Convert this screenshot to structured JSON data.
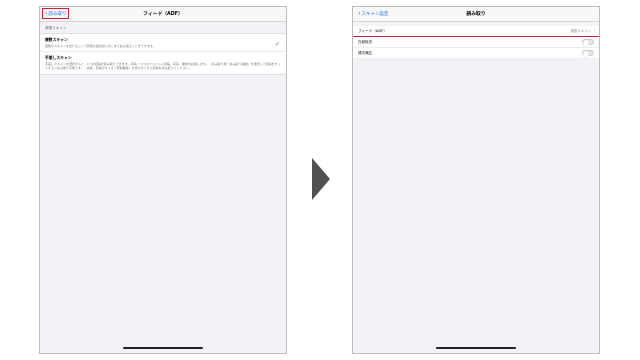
{
  "left": {
    "back": "読み取り",
    "title": "フィード（ADF）",
    "section": "原稿スキャン",
    "options": [
      {
        "title": "複数スキャン",
        "desc": "複数のスキャンを続けることで原稿を連続的にまとめて読み取ることができます。",
        "checked": true
      },
      {
        "title": "手差しスキャン",
        "desc": "手差しスキャンを選択すると、1つの原稿を読み取りできます。原稿：・1つのファイルに原稿、写真、書類を記録します。・読み取り後「読み取り開始」を選択して原稿をセットすると読み取り可能です。・認証、原稿のサイズ（原稿書籍）を合わせてから原稿を読み取ってください。",
        "checked": false
      }
    ]
  },
  "right": {
    "back": "スキャン設定",
    "title": "読み取り",
    "rows": [
      {
        "label": "フィード（ADF）",
        "value": "複数スキャン"
      },
      {
        "label": "白紙除去",
        "toggle": false
      },
      {
        "label": "傾き補正",
        "toggle": false
      }
    ]
  },
  "colors": {
    "accent": "#1a73e8",
    "highlight": "#d3202f"
  }
}
